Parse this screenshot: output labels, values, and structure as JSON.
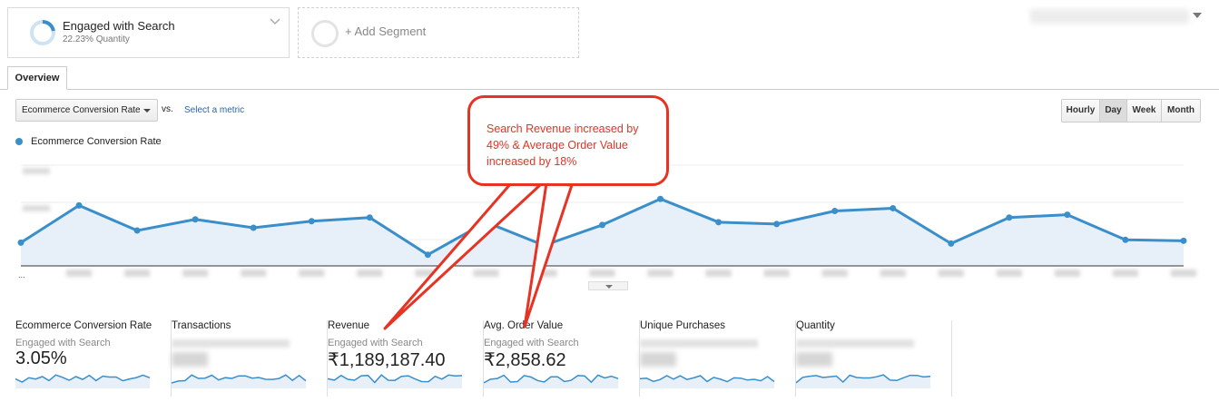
{
  "segments": {
    "active": {
      "title": "Engaged with Search",
      "subtitle": "22.23% Quantity",
      "ring_fraction": 0.2223
    },
    "add": {
      "label": "+ Add Segment"
    }
  },
  "date_range": {
    "icon": "chevron-down-icon"
  },
  "tabs": [
    {
      "label": "Overview"
    }
  ],
  "toolbar": {
    "metric_dropdown": "Ecommerce Conversion Rate",
    "vs_label": "vs.",
    "select_metric_link": "Select a metric",
    "periods": [
      "Hourly",
      "Day",
      "Week",
      "Month"
    ],
    "active_period": "Day"
  },
  "legend": {
    "label": "Ecommerce Conversion Rate"
  },
  "colors": {
    "series": "#3a8fcb",
    "fill": "#e7f0f9",
    "callout": "#e63323",
    "link": "#2a65a8"
  },
  "chart_data": {
    "type": "area",
    "series": [
      {
        "name": "Ecommerce Conversion Rate",
        "values": [
          2.95,
          3.35,
          3.08,
          3.2,
          3.11,
          3.18,
          3.22,
          2.82,
          3.17,
          2.92,
          3.14,
          3.42,
          3.17,
          3.15,
          3.29,
          3.32,
          2.94,
          3.22,
          3.25,
          2.98,
          2.97
        ]
      }
    ],
    "y_range": [
      2.7,
      3.9
    ],
    "grid": true,
    "axis_labels_legible": false
  },
  "callout": {
    "text": "Search Revenue increased by 49% & Average Order Value increased by 18%"
  },
  "scorecards": [
    {
      "title": "Ecommerce Conversion Rate",
      "segment": "Engaged with Search",
      "value": "3.05%",
      "blurred": false
    },
    {
      "title": "Transactions",
      "segment": "",
      "value": "",
      "blurred": true
    },
    {
      "title": "Revenue",
      "segment": "Engaged with Search",
      "value": "₹1,189,187.40",
      "blurred": false
    },
    {
      "title": "Avg. Order Value",
      "segment": "Engaged with Search",
      "value": "₹2,858.62",
      "blurred": false
    },
    {
      "title": "Unique Purchases",
      "segment": "",
      "value": "",
      "blurred": true
    },
    {
      "title": "Quantity",
      "segment": "",
      "value": "",
      "blurred": true
    }
  ]
}
